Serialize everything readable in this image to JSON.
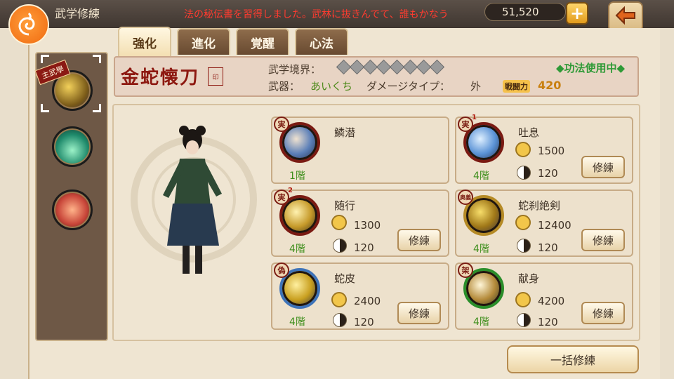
{
  "header": {
    "title": "武学修練",
    "ticker": "法の秘伝書を習得しました。武林に抜きんでて、誰もかなう",
    "currency_value": "51,520",
    "plus_label": "+",
    "back_icon": "back-arrow-icon",
    "logo_icon": "swirl-logo-icon"
  },
  "tabs": [
    {
      "label": "強化",
      "active": true
    },
    {
      "label": "進化",
      "active": false
    },
    {
      "label": "覚醒",
      "active": false
    },
    {
      "label": "心法",
      "active": false
    }
  ],
  "sidebar": {
    "main_tag": "主武學",
    "items": [
      {
        "icon": "golden-snake-skill-icon",
        "selected": true
      },
      {
        "icon": "green-energy-skill-icon",
        "selected": false
      },
      {
        "icon": "red-buddha-skill-icon",
        "selected": false
      }
    ]
  },
  "skill_header": {
    "name": "金蛇懐刀",
    "seal": "印",
    "realm_label": "武学境界：",
    "realm_stars": 8,
    "weapon_label": "武器：",
    "weapon_value": "あいくち",
    "damage_label": "ダメージタイプ：",
    "damage_value": "外",
    "power_label": "戦闘力",
    "power_value": "420",
    "status": "◆功法使用中◆"
  },
  "moves": [
    {
      "name": "鱗潜",
      "badge": "実",
      "badge_sup": "",
      "level": "1階",
      "coin_cost": "",
      "yin_cost": "",
      "has_button": false,
      "orb": "red",
      "icon": "hand-strike-icon"
    },
    {
      "name": "吐息",
      "badge": "実",
      "badge_sup": "1",
      "level": "4階",
      "coin_cost": "1500",
      "yin_cost": "120",
      "has_button": true,
      "orb": "red",
      "icon": "blue-crystal-icon"
    },
    {
      "name": "随行",
      "badge": "実",
      "badge_sup": "2",
      "level": "4階",
      "coin_cost": "1300",
      "yin_cost": "120",
      "has_button": true,
      "orb": "red",
      "icon": "gold-slash-icon"
    },
    {
      "name": "蛇刹絶剣",
      "badge": "奥義",
      "badge_sup": "",
      "level": "4階",
      "coin_cost": "12400",
      "yin_cost": "120",
      "has_button": true,
      "orb": "gold",
      "icon": "gold-snake-icon"
    },
    {
      "name": "蛇皮",
      "badge": "偽",
      "badge_sup": "",
      "level": "4階",
      "coin_cost": "2400",
      "yin_cost": "120",
      "has_button": true,
      "orb": "blue",
      "icon": "gold-swirl-icon"
    },
    {
      "name": "献身",
      "badge": "架",
      "badge_sup": "",
      "level": "4階",
      "coin_cost": "4200",
      "yin_cost": "120",
      "has_button": true,
      "orb": "green",
      "icon": "blade-burst-icon"
    }
  ],
  "train_label": "修練",
  "bulk_train_label": "一括修練",
  "colors": {
    "accent": "#8d1810",
    "level_green": "#3f8f1d",
    "status_green": "#2f9a37",
    "power": "#c9800f"
  }
}
